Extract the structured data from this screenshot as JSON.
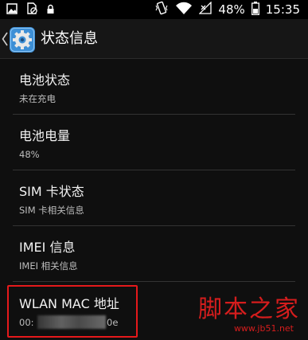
{
  "status_bar": {
    "left_icons": [
      "image-icon",
      "no-sim-icon",
      "lock-icon"
    ],
    "right_icons": [
      "vibrate-icon",
      "wifi-icon",
      "no-signal-icon"
    ],
    "battery_percent": "48%",
    "time": "15:35"
  },
  "action_bar": {
    "back_icon": "chevron-left-icon",
    "app_icon": "settings-gear-icon",
    "title": "状态信息"
  },
  "items": [
    {
      "title": "电池状态",
      "subtitle": "未在充电"
    },
    {
      "title": "电池电量",
      "subtitle": "48%"
    },
    {
      "title": "SIM 卡状态",
      "subtitle": "SIM 卡相关信息"
    },
    {
      "title": "IMEI 信息",
      "subtitle": "IMEI 相关信息"
    },
    {
      "title": "WLAN MAC 地址",
      "subtitle_prefix": "00:",
      "subtitle_suffix": "0e"
    }
  ],
  "colors": {
    "highlight": "#e5191b",
    "watermark": "#d51d1d",
    "accent_icon": "#3d8fd6"
  },
  "watermark": {
    "text": "脚本之家",
    "url": "www.jb51.net"
  }
}
